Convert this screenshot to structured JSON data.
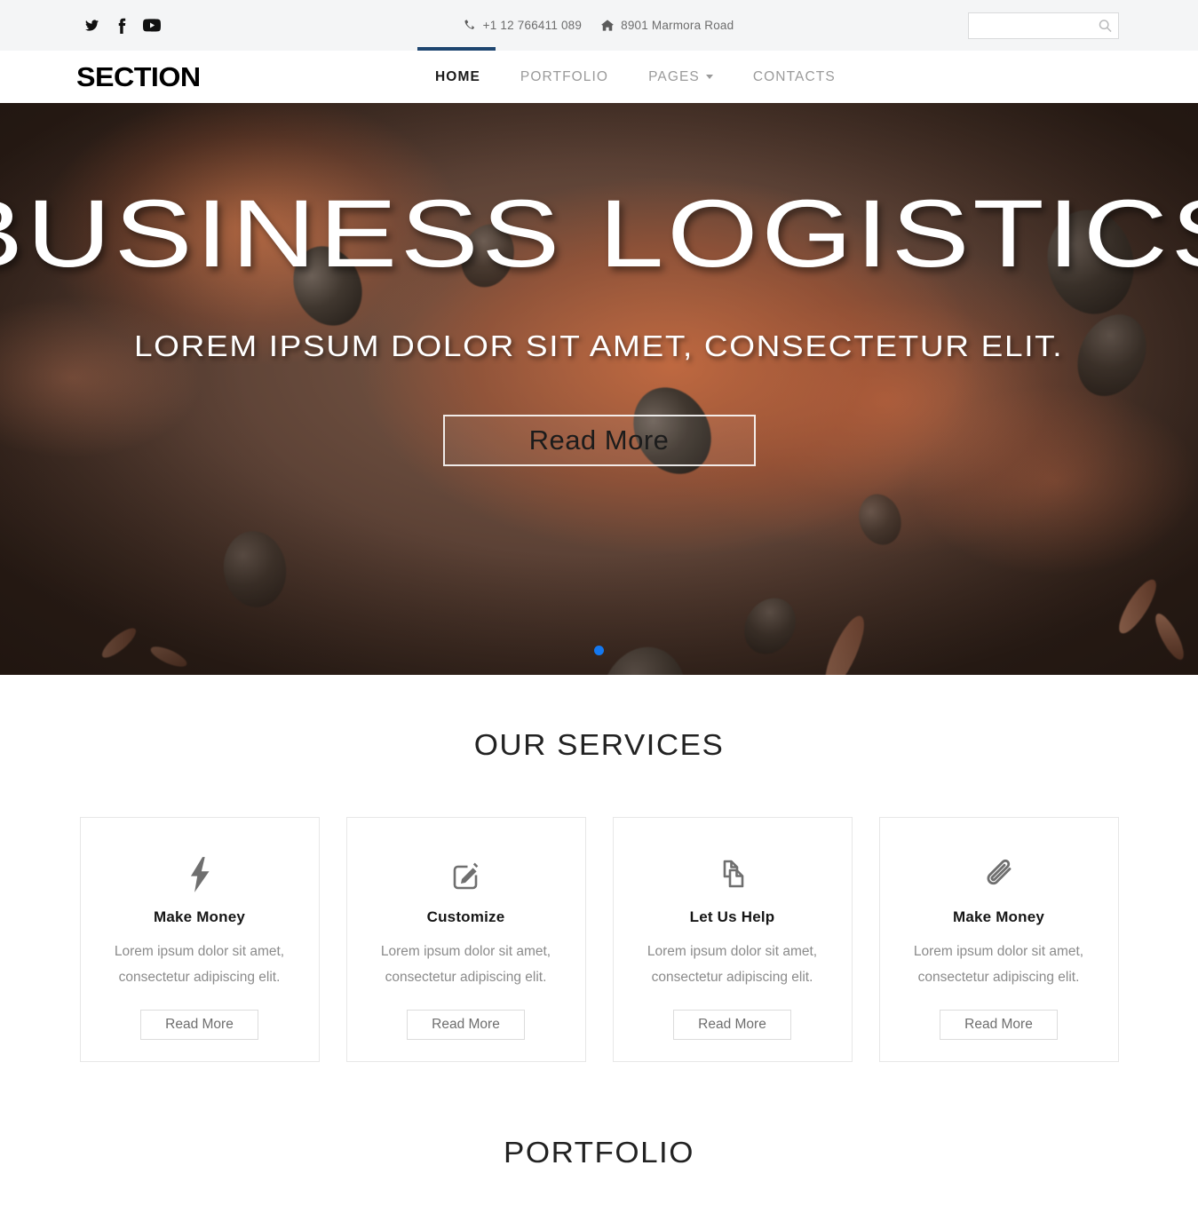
{
  "topbar": {
    "social": [
      {
        "name": "twitter-icon",
        "label": "Twitter"
      },
      {
        "name": "facebook-icon",
        "label": "Facebook"
      },
      {
        "name": "youtube-icon",
        "label": "YouTube"
      }
    ],
    "phone": "+1 12 766411 089",
    "address": "8901 Marmora Road",
    "search": {
      "value": "",
      "placeholder": ""
    }
  },
  "header": {
    "logo": "SECTION",
    "nav": [
      {
        "label": "HOME",
        "active": true,
        "dropdown": false
      },
      {
        "label": "PORTFOLIO",
        "active": false,
        "dropdown": false
      },
      {
        "label": "PAGES",
        "active": false,
        "dropdown": true
      },
      {
        "label": "CONTACTS",
        "active": false,
        "dropdown": false
      }
    ]
  },
  "hero": {
    "title": "BUSINESS LOGISTICS",
    "subtitle": "LOREM IPSUM DOLOR SIT AMET, CONSECTETUR ELIT.",
    "button": "Read More",
    "slides_total": 1,
    "active_slide": 1
  },
  "services": {
    "heading": "OUR SERVICES",
    "cards": [
      {
        "icon": "bolt-icon",
        "title": "Make Money",
        "line1": "Lorem ipsum dolor sit amet,",
        "line2": "consectetur adipiscing elit.",
        "button": "Read More"
      },
      {
        "icon": "pencil-square-icon",
        "title": "Customize",
        "line1": "Lorem ipsum dolor sit amet,",
        "line2": "consectetur adipiscing elit.",
        "button": "Read More"
      },
      {
        "icon": "copy-pages-icon",
        "title": "Let Us Help",
        "line1": "Lorem ipsum dolor sit amet,",
        "line2": "consectetur adipiscing elit.",
        "button": "Read More"
      },
      {
        "icon": "paperclip-icon",
        "title": "Make Money",
        "line1": "Lorem ipsum dolor sit amet,",
        "line2": "consectetur adipiscing elit.",
        "button": "Read More"
      }
    ]
  },
  "portfolio": {
    "heading": "PORTFOLIO"
  },
  "colors": {
    "accent_blue": "#1e4670",
    "dot_blue": "#1478f0",
    "topbar_bg": "#f4f5f6",
    "muted_text": "#8b8b8b",
    "border": "#e7e7e7"
  }
}
